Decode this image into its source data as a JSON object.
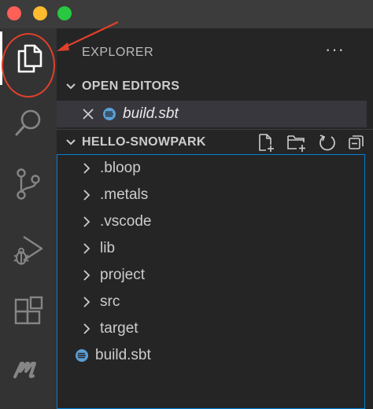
{
  "window": {
    "traffic_lights": [
      "close",
      "minimize",
      "zoom"
    ]
  },
  "activity_bar": {
    "items": [
      "files-icon",
      "search-icon",
      "source-control-icon",
      "run-debug-icon",
      "extensions-icon",
      "metals-icon"
    ],
    "active": "files-icon"
  },
  "explorer": {
    "title": "EXPLORER",
    "more": "···"
  },
  "open_editors": {
    "title": "OPEN EDITORS",
    "items": [
      {
        "label": "build.sbt"
      }
    ]
  },
  "workspace": {
    "title": "HELLO-SNOWPARK",
    "actions": [
      "new-file-icon",
      "new-folder-icon",
      "refresh-icon",
      "collapse-all-icon"
    ],
    "folders": [
      ".bloop",
      ".metals",
      ".vscode",
      "lib",
      "project",
      "src",
      "target"
    ],
    "files": [
      "build.sbt"
    ]
  },
  "colors": {
    "annotation": "#e0402a",
    "focus_border": "#007fd4",
    "sbt_icon": "#5a9fd6"
  }
}
